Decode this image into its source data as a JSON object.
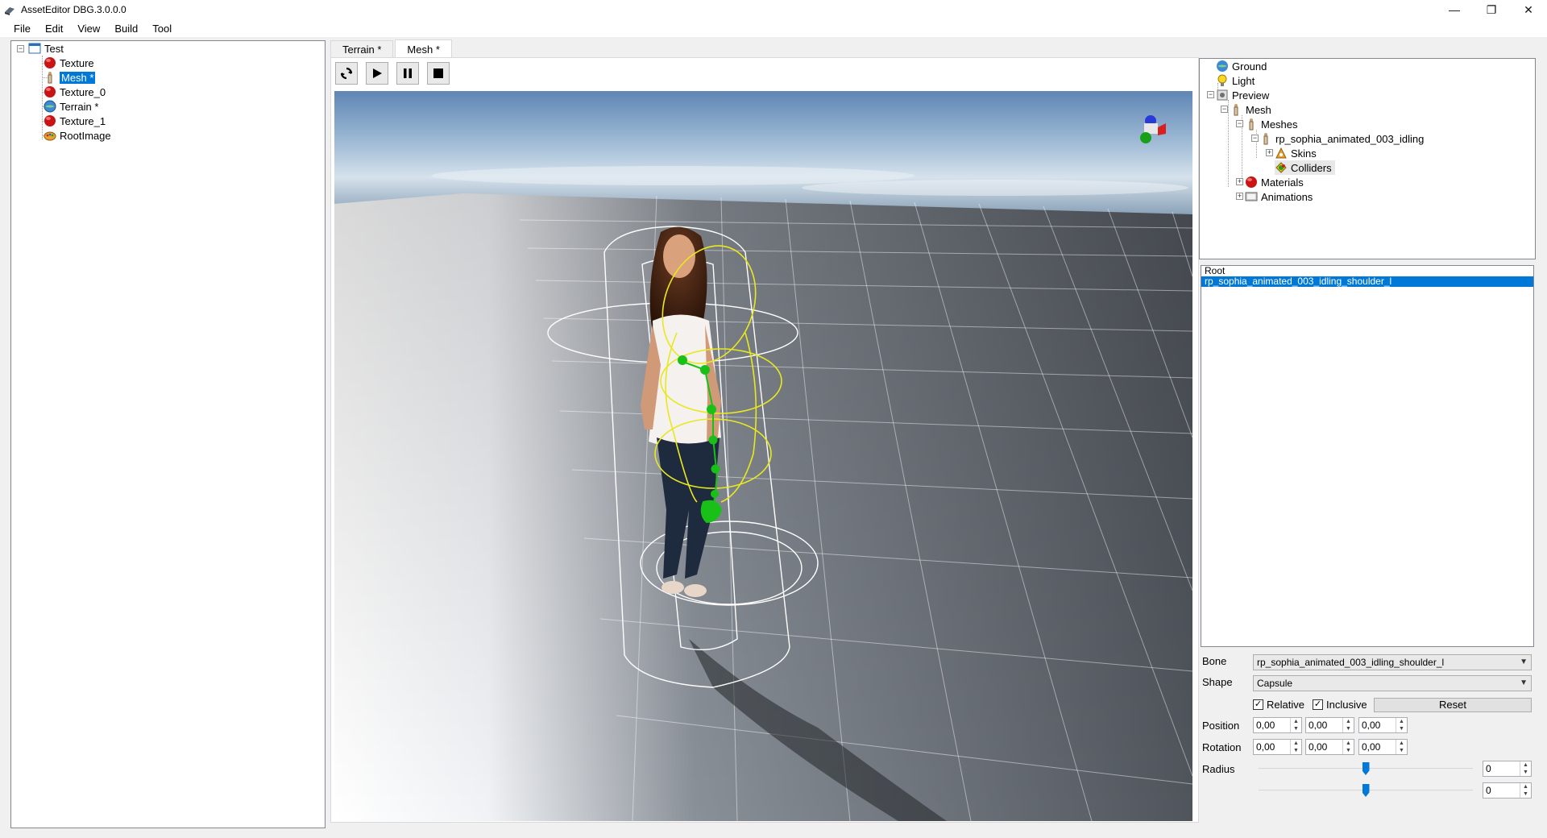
{
  "window": {
    "title": "AssetEditor DBG.3.0.0.0",
    "minimize": "—",
    "restore": "❐",
    "close": "✕"
  },
  "menu": [
    "File",
    "Edit",
    "View",
    "Build",
    "Tool"
  ],
  "project_tree": {
    "root": "Test",
    "items": [
      {
        "label": "Texture",
        "icon": "red-sphere-icon"
      },
      {
        "label": "Mesh *",
        "icon": "mesh-figure-icon",
        "selected": true
      },
      {
        "label": "Texture_0",
        "icon": "red-sphere-icon"
      },
      {
        "label": "Terrain *",
        "icon": "globe-icon"
      },
      {
        "label": "Texture_1",
        "icon": "red-sphere-icon"
      },
      {
        "label": "RootImage",
        "icon": "palette-icon"
      }
    ]
  },
  "tabs": [
    {
      "label": "Terrain *",
      "active": false
    },
    {
      "label": "Mesh *",
      "active": true
    }
  ],
  "toolbar": [
    "refresh-icon",
    "play-icon",
    "pause-icon",
    "stop-icon"
  ],
  "scene_tree": {
    "ground": "Ground",
    "light": "Light",
    "preview": "Preview",
    "mesh": "Mesh",
    "meshes": "Meshes",
    "mesh_name": "rp_sophia_animated_003_idling",
    "skins": "Skins",
    "colliders": "Colliders",
    "materials": "Materials",
    "animations": "Animations"
  },
  "bone_list": {
    "items": [
      "Root",
      "rp_sophia_animated_003_idling_shoulder_l"
    ],
    "selected_index": 1
  },
  "props": {
    "bone_label": "Bone",
    "bone_value": "rp_sophia_animated_003_idling_shoulder_l",
    "shape_label": "Shape",
    "shape_value": "Capsule",
    "relative_label": "Relative",
    "relative_checked": true,
    "inclusive_label": "Inclusive",
    "inclusive_checked": true,
    "reset_label": "Reset",
    "position_label": "Position",
    "position": [
      "0,00",
      "0,00",
      "0,00"
    ],
    "rotation_label": "Rotation",
    "rotation": [
      "0,00",
      "0,00",
      "0,00"
    ],
    "radius_label": "Radius",
    "radius_value": "0",
    "height_value": "0",
    "radius_slider_fraction": 0.5,
    "height_slider_fraction": 0.5
  },
  "colors": {
    "selection": "#0078d7",
    "collider": "#e8e820",
    "bone": "#18c018"
  }
}
